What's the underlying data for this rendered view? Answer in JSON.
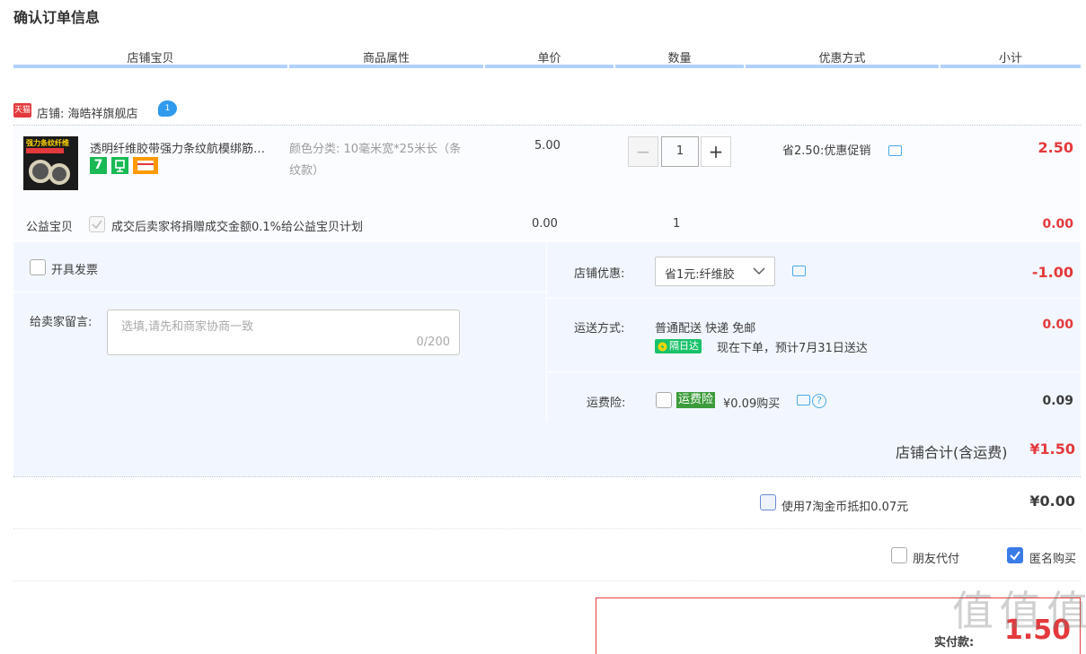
{
  "page_title": "确认订单信息",
  "columns": [
    "店铺宝贝",
    "商品属性",
    "单价",
    "数量",
    "优惠方式",
    "小计"
  ],
  "shop": {
    "badge": "天猫",
    "name": "店铺: 海皓祥旗舰店",
    "ww_badge": "1"
  },
  "item": {
    "thumb_text": "强力条纹纤维",
    "title": "透明纤维胶带强力条纹航模绑筋…",
    "sku_label": "颜色分类:",
    "sku_value": "10毫米宽*25米长（条纹款）",
    "price": "5.00",
    "qty_minus": "−",
    "qty": "1",
    "qty_plus": "+",
    "promo": "省2.50:优惠促销",
    "subtotal": "2.50",
    "tag_seven": "7"
  },
  "charity": {
    "label": "公益宝贝",
    "text": "成交后卖家将捐赠成交金额0.1%给公益宝贝计划",
    "price": "0.00",
    "qty": "1",
    "subtotal": "0.00"
  },
  "invoice": {
    "label": "开具发票"
  },
  "message": {
    "label": "给卖家留言:",
    "placeholder": "选填,请先和商家协商一致",
    "counter": "0/200"
  },
  "shop_discount": {
    "label": "店铺优惠:",
    "selected": "省1元:纤维胶",
    "amount": "-1.00"
  },
  "delivery": {
    "label": "运送方式:",
    "method": "普通配送 快递 免邮",
    "tag": "隔日达",
    "eta": "现在下单，预计7月31日送达",
    "amount": "0.00"
  },
  "insurance": {
    "label": "运费险:",
    "tag": "运费险",
    "price_text": "¥0.09购买",
    "help": "?",
    "amount": "0.09"
  },
  "shop_total": {
    "label": "店铺合计(含运费)",
    "amount": "¥1.50"
  },
  "coins": {
    "label": "使用7淘金币抵扣0.07元",
    "amount": "¥0.00"
  },
  "options": {
    "friend_pay": "朋友代付",
    "anonymous": "匿名购买",
    "anonymous_checked": true
  },
  "payment": {
    "label": "实付款:",
    "amount": "1.50"
  },
  "watermark": "值 值 值",
  "colors": {
    "accent_red": "#e4393c",
    "header_line": "#b2d1ff",
    "panel_bg": "#f2f7ff",
    "check_blue": "#3a7be8"
  }
}
